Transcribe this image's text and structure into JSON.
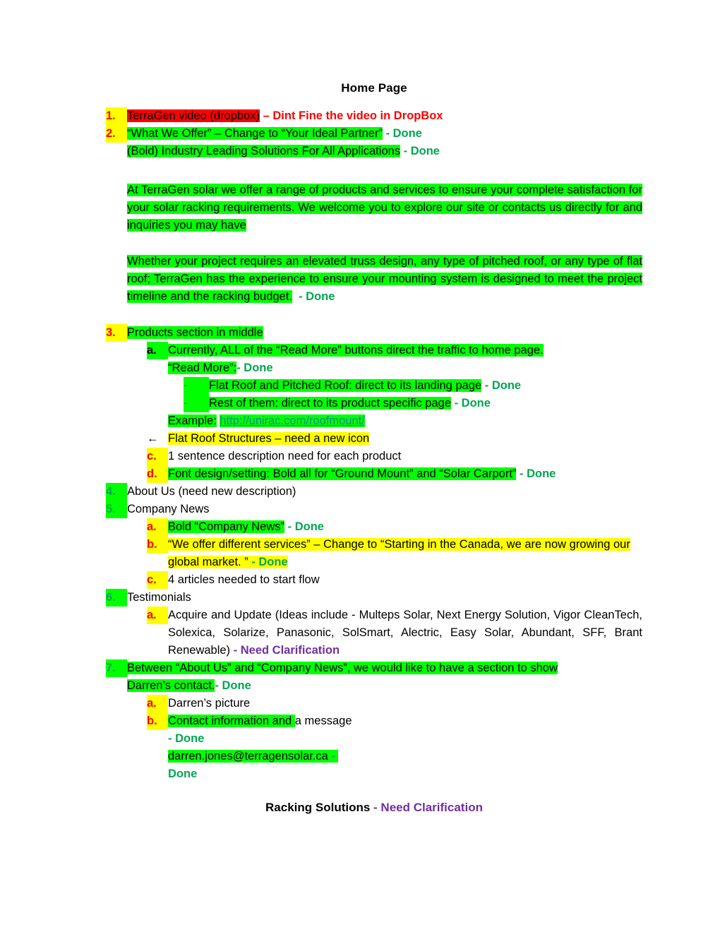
{
  "document": {
    "title": "Home Page",
    "footer_title": "Racking Solutions",
    "footer_status": "- Need Clarification"
  },
  "labels": {
    "done": "- Done",
    "done_word": "Done",
    "dash": "-",
    "need_clarification": "- Need Clarification",
    "marker_1": "1.",
    "marker_2": "2.",
    "marker_3": "3.",
    "marker_4": "4.",
    "marker_5": "5.",
    "marker_6": "6.",
    "marker_7": "7.",
    "marker_a": "a.",
    "marker_b": "b.",
    "marker_c": "c.",
    "marker_d": "d.",
    "marker_dash": "-",
    "marker_arrow": "←"
  },
  "items": {
    "item1": {
      "text_highlight_red": "TerraGen video (dropbox)",
      "note_red": "– Dint  Fine the video in DropBox"
    },
    "item2": {
      "line1": "“What We Offer” – Change to “Your Ideal Partner”",
      "line1_status": "- Done",
      "line2": "(Bold) Industry Leading Solutions For All Applications",
      "line2_status": "- Done"
    },
    "paragraph1": "At TerraGen solar we offer a range of products and services to ensure your complete satisfaction for your solar racking requirements. We welcome you to explore our site or contacts us directly for and inquiries you may have",
    "paragraph2": "Whether your project requires an elevated truss design, any type of pitched roof, or any type of flat roof; TerraGen has the experience to ensure your mounting system is designed to meet the project timeline and the racking budget.",
    "paragraph2_status": "- Done",
    "item3": {
      "heading": "Products section in middle",
      "a_text": "Currently, ALL of the “Read More” buttons direct the traffic to home page.",
      "a_sub_label": "“Read More”:",
      "a_sub_label_status": "- Done",
      "a_sub1": "Flat Roof and Pitched Roof: direct to its landing page",
      "a_sub1_status": "- Done",
      "a_sub2": "Rest of them: direct to its product specific page",
      "a_sub2_status": "- Done",
      "example_label": "Example:",
      "example_url": "http://unirac.com/roofmount/",
      "b_text": "Flat Roof Structures – need a new icon",
      "c_text": "1 sentence description need for each product",
      "d_text": "Font design/setting: Bold all for “Ground Mount” and “Solar Carport”",
      "d_status": "- Done"
    },
    "item4": {
      "text": "About Us (need new description)"
    },
    "item5": {
      "heading": "Company News",
      "a_text": "Bold “Company News”",
      "a_status": "- Done",
      "b_text": "“We offer different services” – Change to “Starting in the Canada, we are now growing our global market. ”",
      "b_status": "- Done",
      "c_text": "4 articles needed to start flow"
    },
    "item6": {
      "heading": "Testimonials",
      "a_text": "Acquire and Update (Ideas include - Multeps Solar, Next Energy Solution, Vigor CleanTech, Solexica, Solarize, Panasonic, SolSmart, Alectric, Easy Solar, Abundant, SFF, Brant Renewable)",
      "a_status": "- Need Clarification"
    },
    "item7": {
      "text_line1": "Between “About Us” and “Company News”, we would like to have a section to show",
      "text_line2": "Darren’s contact.",
      "status": "- Done",
      "a_text": "Darren’s picture",
      "b_text_highlight": "Contact information and",
      "b_text_plain": "a message",
      "b_status": "- Done",
      "email": "darren.jones@terragensolar.ca",
      "email_status_dash": "-",
      "email_status_word": "Done"
    }
  },
  "colors": {
    "highlight_green": "#00ff00",
    "highlight_yellow": "#ffff00",
    "highlight_red": "#ff0000",
    "text_red": "#ff0000",
    "text_done_green": "#00a651",
    "text_purple": "#7030a0",
    "text_link": "#0e8c8c"
  }
}
